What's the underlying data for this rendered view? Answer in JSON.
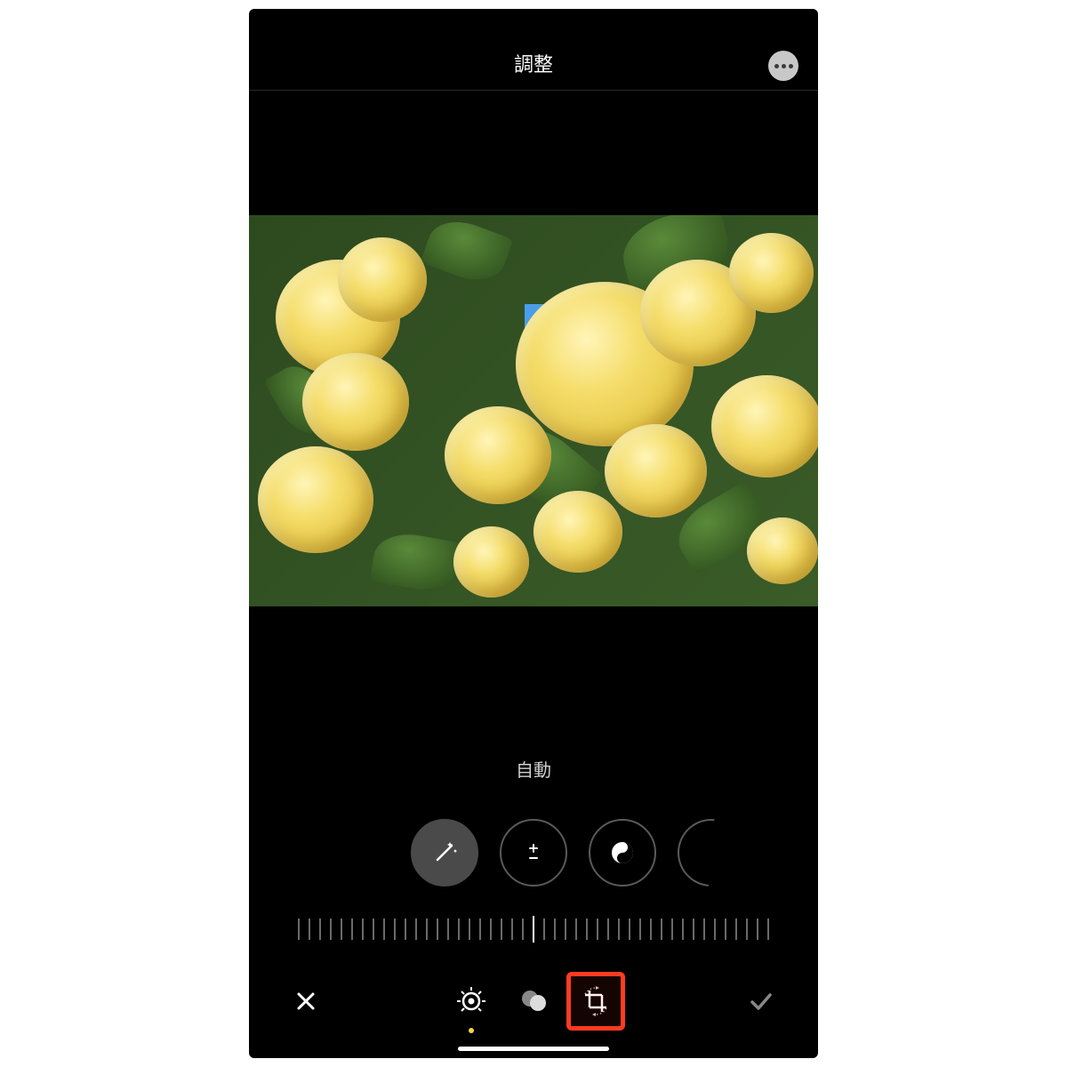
{
  "header": {
    "title": "調整",
    "more_icon": "more-horizontal-icon"
  },
  "photo": {
    "description": "yellow-flowers-photo"
  },
  "adjust": {
    "sub_label": "自動",
    "tools": [
      {
        "name": "auto-magic-wand",
        "active": true
      },
      {
        "name": "exposure",
        "active": false
      },
      {
        "name": "brilliance",
        "active": false
      }
    ]
  },
  "bottom_bar": {
    "cancel_icon": "close-icon",
    "adjust_icon": "adjust-dial-icon",
    "filters_icon": "filters-circles-icon",
    "crop_icon": "crop-rotate-icon",
    "done_icon": "checkmark-icon",
    "active_tab": "adjust",
    "highlighted": "crop"
  },
  "colors": {
    "highlight": "#ff3b1f",
    "accent_dot": "#f5d742"
  }
}
